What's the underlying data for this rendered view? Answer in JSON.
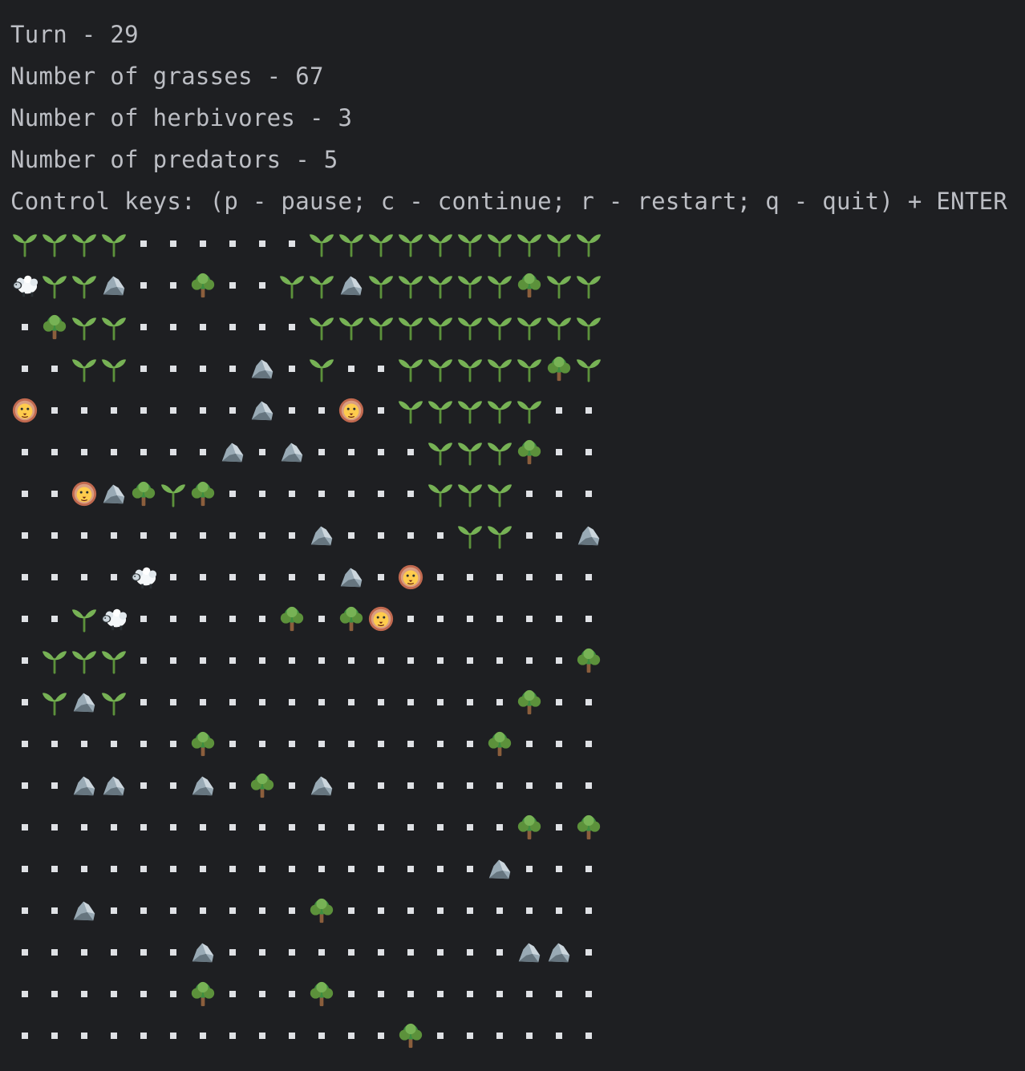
{
  "console": {
    "turn": "Turn - 29",
    "grasses": "Number of grasses - 67",
    "herbivores": "Number of herbivores - 3",
    "predators": "Number of predators - 5",
    "controls": "Control keys: (p - pause; c - continue; r - restart; q - quit) + ENTER"
  },
  "legend": {
    ".": "empty",
    "G": "grass",
    "T": "tree",
    "R": "rock",
    "S": "sheep",
    "L": "lion"
  },
  "colors": {
    "background": "#1e1f22",
    "text": "#bcbec4",
    "dot": "#dfe1e5"
  },
  "grid": [
    "GGGG......GGGGGGGGGG",
    "SGGR..T..GGRGGGGGTGG",
    ".TGG......GGGGGGGGGG",
    "..GG....R.G..GGGGGTG",
    "L.......R..L.GGGGG..",
    ".......R.R....GGGT..",
    "..LRTGT.......GGG...",
    "..........R....GG..R",
    "....S......R.L......",
    "..GS.....T.TL.......",
    ".GGG...............T",
    ".GRG.............T..",
    "......T.........T...",
    "..RR..R.T.R.........",
    ".................T.T",
    "................R...",
    "..R.......T.........",
    "......R..........RR.",
    "......T...T.........",
    ".............T......"
  ]
}
